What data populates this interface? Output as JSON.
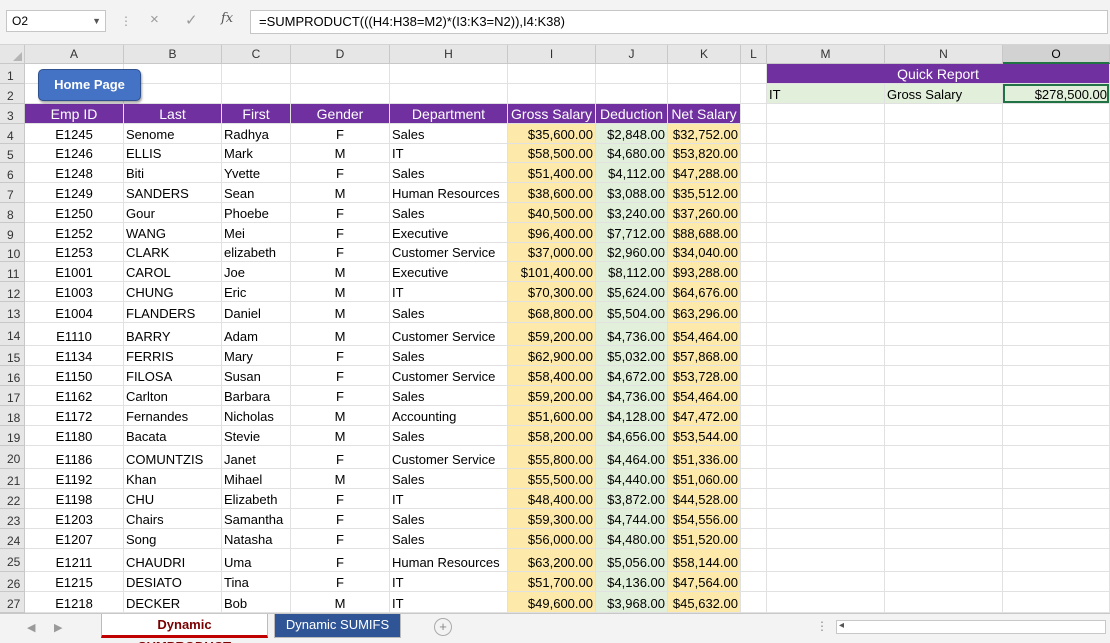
{
  "formula_bar": {
    "name_box": "O2",
    "cancel_icon": "×",
    "enter_icon": "✓",
    "fx_label": "fx",
    "formula": "=SUMPRODUCT(((H4:H38=M2)*(I3:K3=N2)),I4:K38)"
  },
  "columns": [
    "A",
    "B",
    "C",
    "D",
    "H",
    "I",
    "J",
    "K",
    "L",
    "M",
    "N",
    "O"
  ],
  "row_numbers": [
    "1",
    "2",
    "3",
    "4",
    "5",
    "6",
    "7",
    "8",
    "9",
    "10",
    "11",
    "12",
    "13",
    "14",
    "15",
    "16",
    "17",
    "18",
    "19",
    "20",
    "21",
    "22",
    "23",
    "24",
    "25",
    "26",
    "27"
  ],
  "home_button": "Home Page",
  "table": {
    "headers": [
      "Emp ID",
      "Last",
      "First",
      "Gender",
      "Department",
      "Gross Salary",
      "Deduction",
      "Net Salary"
    ],
    "rows": [
      [
        "E1245",
        "Senome",
        "Radhya",
        "F",
        "Sales",
        "$35,600.00",
        "$2,848.00",
        "$32,752.00"
      ],
      [
        "E1246",
        "ELLIS",
        "Mark",
        "M",
        "IT",
        "$58,500.00",
        "$4,680.00",
        "$53,820.00"
      ],
      [
        "E1248",
        "Biti",
        "Yvette",
        "F",
        "Sales",
        "$51,400.00",
        "$4,112.00",
        "$47,288.00"
      ],
      [
        "E1249",
        "SANDERS",
        "Sean",
        "M",
        "Human Resources",
        "$38,600.00",
        "$3,088.00",
        "$35,512.00"
      ],
      [
        "E1250",
        "Gour",
        "Phoebe",
        "F",
        "Sales",
        "$40,500.00",
        "$3,240.00",
        "$37,260.00"
      ],
      [
        "E1252",
        "WANG",
        "Mei",
        "F",
        "Executive",
        "$96,400.00",
        "$7,712.00",
        "$88,688.00"
      ],
      [
        "E1253",
        "CLARK",
        "elizabeth",
        "F",
        "Customer Service",
        "$37,000.00",
        "$2,960.00",
        "$34,040.00"
      ],
      [
        "E1001",
        "CAROL",
        "Joe",
        "M",
        "Executive",
        "$101,400.00",
        "$8,112.00",
        "$93,288.00"
      ],
      [
        "E1003",
        "CHUNG",
        "Eric",
        "M",
        "IT",
        "$70,300.00",
        "$5,624.00",
        "$64,676.00"
      ],
      [
        "E1004",
        "FLANDERS",
        "Daniel",
        "M",
        "Sales",
        "$68,800.00",
        "$5,504.00",
        "$63,296.00"
      ],
      [
        "E1110",
        "BARRY",
        "Adam",
        "M",
        "Customer Service",
        "$59,200.00",
        "$4,736.00",
        "$54,464.00"
      ],
      [
        "E1134",
        "FERRIS",
        "Mary",
        "F",
        "Sales",
        "$62,900.00",
        "$5,032.00",
        "$57,868.00"
      ],
      [
        "E1150",
        "FILOSA",
        "Susan",
        "F",
        "Customer Service",
        "$58,400.00",
        "$4,672.00",
        "$53,728.00"
      ],
      [
        "E1162",
        "Carlton",
        "Barbara",
        "F",
        "Sales",
        "$59,200.00",
        "$4,736.00",
        "$54,464.00"
      ],
      [
        "E1172",
        "Fernandes",
        "Nicholas",
        "M",
        "Accounting",
        "$51,600.00",
        "$4,128.00",
        "$47,472.00"
      ],
      [
        "E1180",
        "Bacata",
        "Stevie",
        "M",
        "Sales",
        "$58,200.00",
        "$4,656.00",
        "$53,544.00"
      ],
      [
        "E1186",
        "COMUNTZIS",
        "Janet",
        "F",
        "Customer Service",
        "$55,800.00",
        "$4,464.00",
        "$51,336.00"
      ],
      [
        "E1192",
        "Khan",
        "Mihael",
        "M",
        "Sales",
        "$55,500.00",
        "$4,440.00",
        "$51,060.00"
      ],
      [
        "E1198",
        "CHU",
        "Elizabeth",
        "F",
        "IT",
        "$48,400.00",
        "$3,872.00",
        "$44,528.00"
      ],
      [
        "E1203",
        "Chairs",
        "Samantha",
        "F",
        "Sales",
        "$59,300.00",
        "$4,744.00",
        "$54,556.00"
      ],
      [
        "E1207",
        "Song",
        "Natasha",
        "F",
        "Sales",
        "$56,000.00",
        "$4,480.00",
        "$51,520.00"
      ],
      [
        "E1211",
        "CHAUDRI",
        "Uma",
        "F",
        "Human Resources",
        "$63,200.00",
        "$5,056.00",
        "$58,144.00"
      ],
      [
        "E1215",
        "DESIATO",
        "Tina",
        "F",
        "IT",
        "$51,700.00",
        "$4,136.00",
        "$47,564.00"
      ],
      [
        "E1218",
        "DECKER",
        "Bob",
        "M",
        "IT",
        "$49,600.00",
        "$3,968.00",
        "$45,632.00"
      ]
    ]
  },
  "quick_report": {
    "title": "Quick Report",
    "department": "IT",
    "metric": "Gross Salary",
    "result": "$278,500.00"
  },
  "sheet_tabs": {
    "active": "Dynamic SUMPRODUCT",
    "other": "Dynamic SUMIFS",
    "add_icon": "+",
    "menu_icon": "⋮"
  },
  "colors": {
    "header_purple": "#7030a0",
    "salary_yellow": "#fde9a9",
    "deduction_green": "#e2efda",
    "button_blue": "#4472c4",
    "excel_green": "#217346"
  }
}
